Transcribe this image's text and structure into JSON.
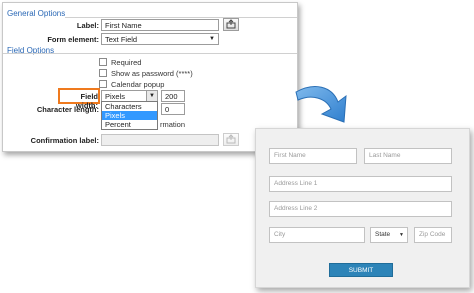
{
  "general_options": {
    "title": "General Options",
    "label_label": "Label:",
    "label_value": "First Name",
    "form_element_label": "Form element:",
    "form_element_value": "Text Field"
  },
  "field_options": {
    "title": "Field Options",
    "checkboxes": [
      {
        "label": "Required"
      },
      {
        "label": "Show as password (****)"
      },
      {
        "label": "Calendar popup"
      }
    ],
    "field_width_label": "Field width:",
    "field_width_unit": "Pixels",
    "field_width_value": "200",
    "character_length_label": "Character length:",
    "character_length_value": "0",
    "confirmation_fragment": "rmation",
    "confirmation_label": "Confirmation label:",
    "dropdown_options": [
      "Characters",
      "Pixels",
      "Percent"
    ],
    "dropdown_selected": "Pixels"
  },
  "preview": {
    "first_name_placeholder": "First Name",
    "last_name_placeholder": "Last Name",
    "address1_placeholder": "Address Line 1",
    "address2_placeholder": "Address Line 2",
    "city_placeholder": "City",
    "state_value": "State",
    "zip_placeholder": "Zip Code",
    "submit_label": "SUBMIT"
  },
  "colors": {
    "section_title": "#2a68b6",
    "highlight": "#ef7a1e",
    "selected_option": "#3399ff",
    "submit_button": "#2d84b8",
    "arrow": "#3a8ed8"
  },
  "icons": [
    "share-icon",
    "chevron-down-icon",
    "curved-arrow-icon"
  ]
}
